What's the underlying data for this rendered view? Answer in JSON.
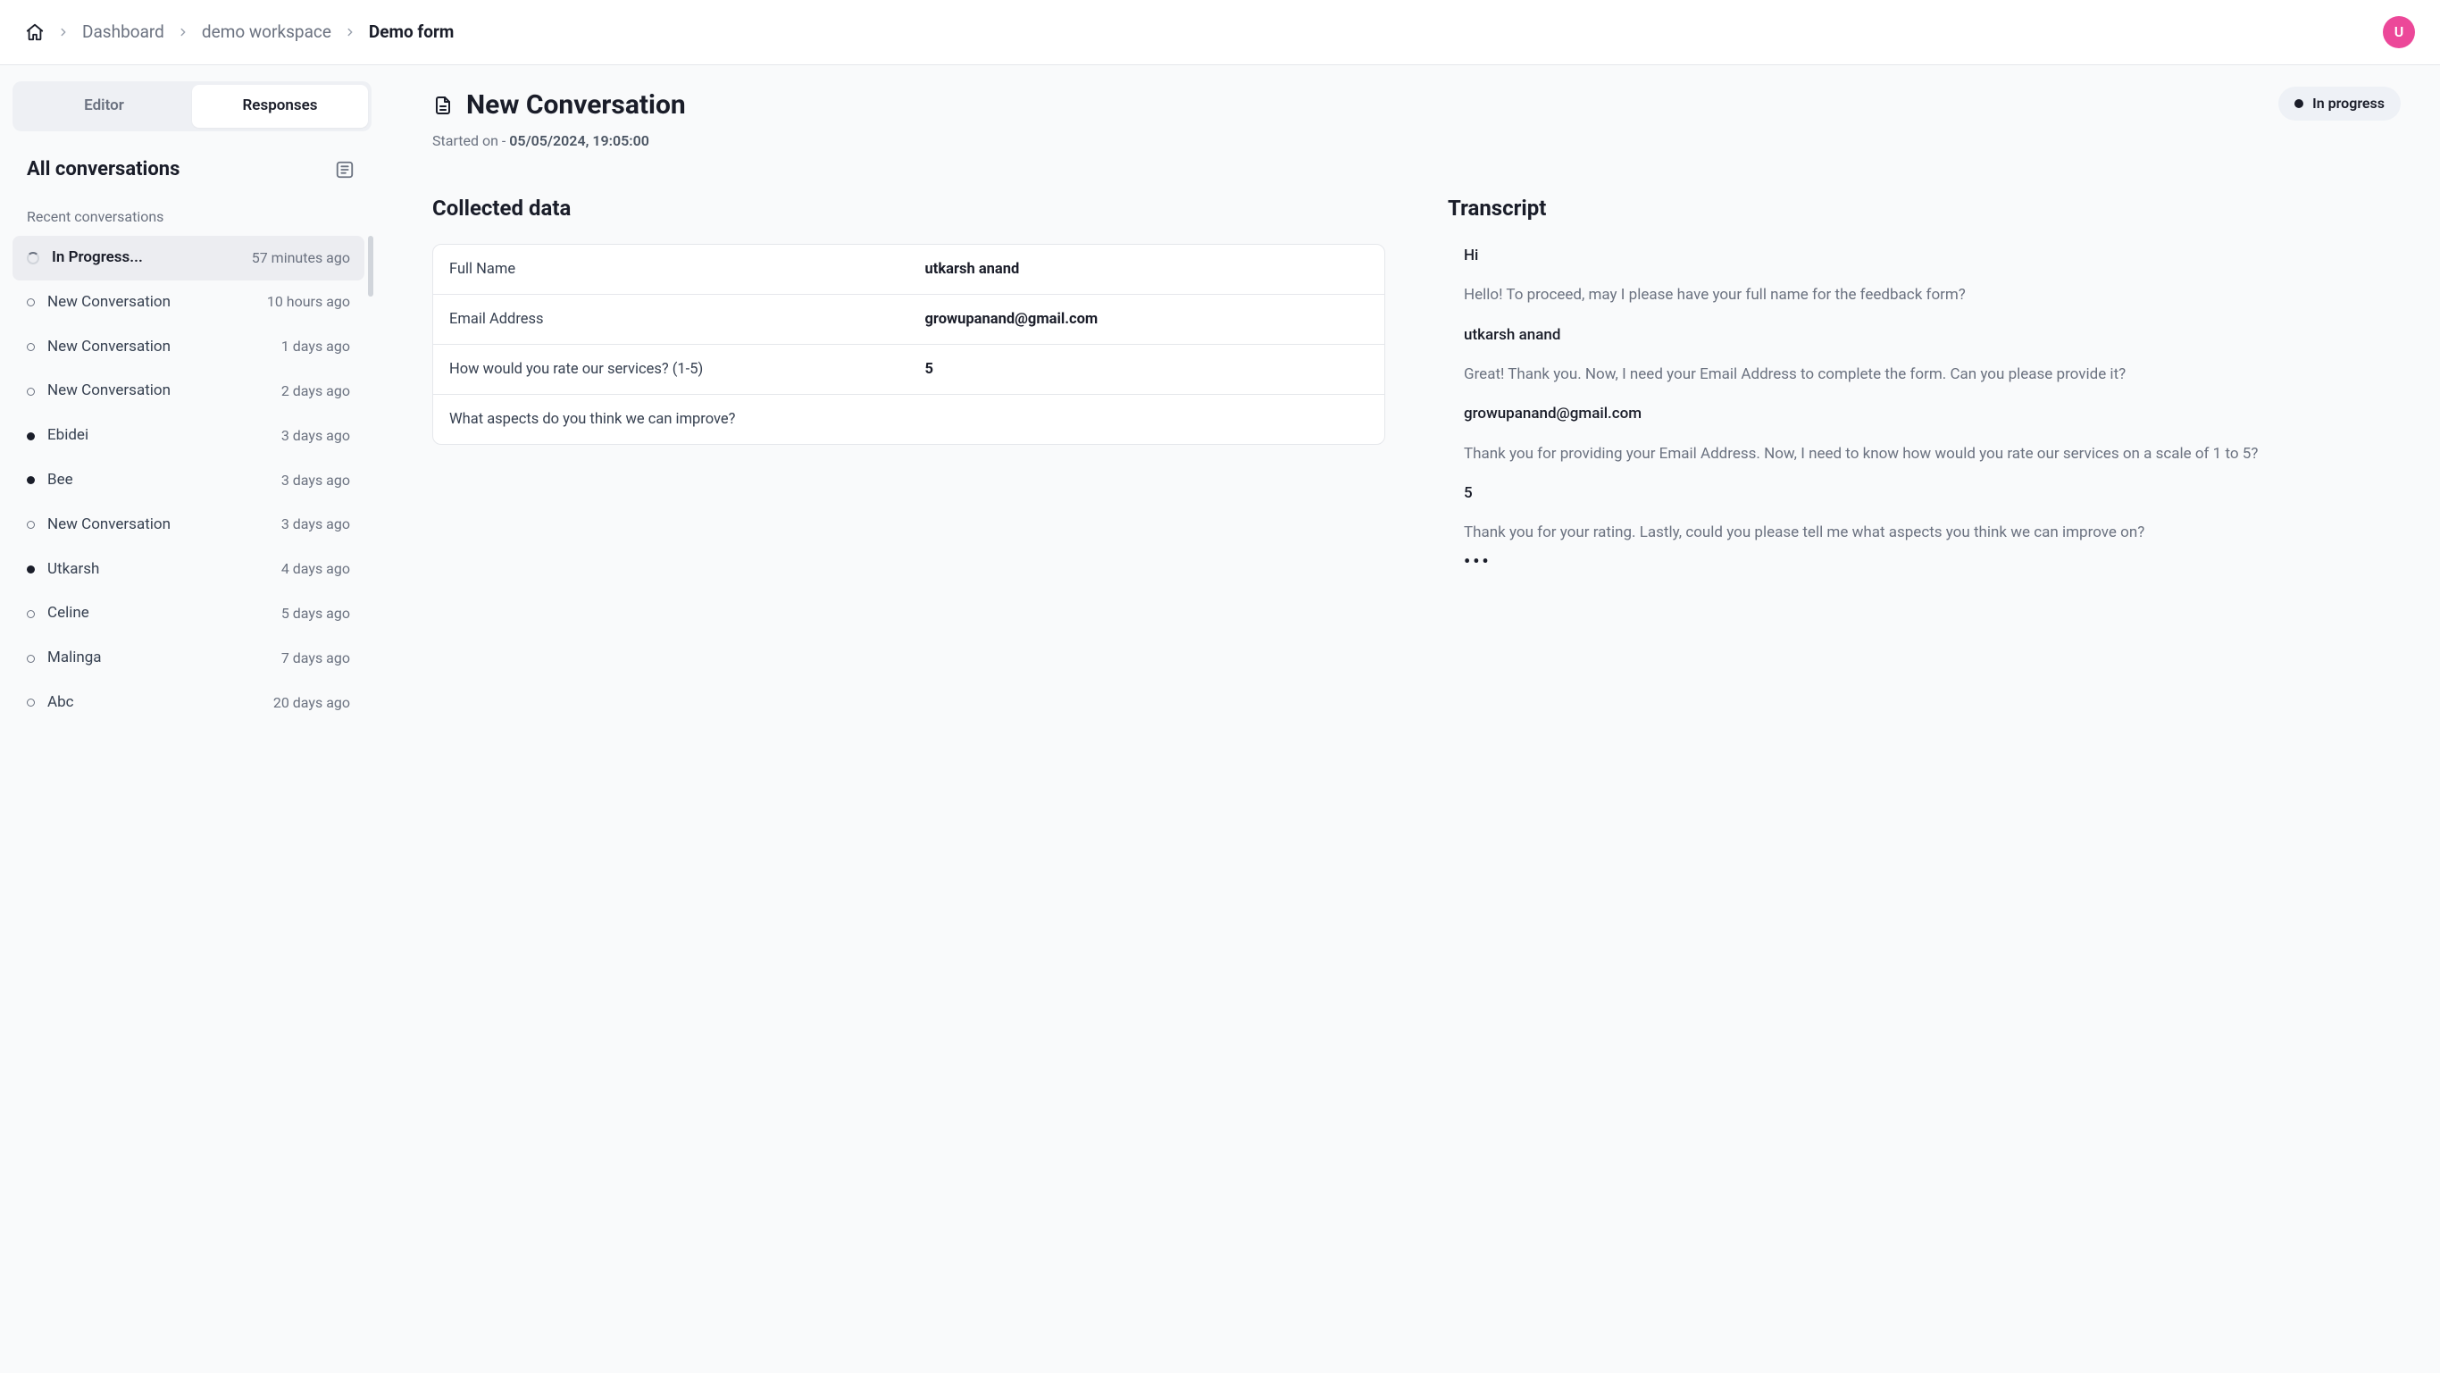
{
  "breadcrumb": {
    "items": [
      {
        "label": "Dashboard"
      },
      {
        "label": "demo workspace"
      },
      {
        "label": "Demo form"
      }
    ]
  },
  "avatar": {
    "initial": "U"
  },
  "sidebar": {
    "tabs": [
      {
        "label": "Editor"
      },
      {
        "label": "Responses"
      }
    ],
    "active_tab_index": 1,
    "title": "All conversations",
    "section_label": "Recent conversations",
    "conversations": [
      {
        "title": "In Progress...",
        "time": "57 minutes ago",
        "status": "spinner",
        "active": true
      },
      {
        "title": "New Conversation",
        "time": "10 hours ago",
        "status": "open"
      },
      {
        "title": "New Conversation",
        "time": "1 days ago",
        "status": "open"
      },
      {
        "title": "New Conversation",
        "time": "2 days ago",
        "status": "open"
      },
      {
        "title": "Ebidei",
        "time": "3 days ago",
        "status": "closed"
      },
      {
        "title": "Bee",
        "time": "3 days ago",
        "status": "closed"
      },
      {
        "title": "New Conversation",
        "time": "3 days ago",
        "status": "open"
      },
      {
        "title": "Utkarsh",
        "time": "4 days ago",
        "status": "closed"
      },
      {
        "title": "Celine",
        "time": "5 days ago",
        "status": "open"
      },
      {
        "title": "Malinga",
        "time": "7 days ago",
        "status": "open"
      },
      {
        "title": "Abc",
        "time": "20 days ago",
        "status": "open"
      }
    ]
  },
  "content": {
    "title": "New Conversation",
    "started_label": "Started on - ",
    "started_ts": "05/05/2024, 19:05:00",
    "status_label": "In progress",
    "collected_heading": "Collected data",
    "collected": [
      {
        "label": "Full Name",
        "value": "utkarsh anand"
      },
      {
        "label": "Email Address",
        "value": "growupanand@gmail.com"
      },
      {
        "label": "How would you rate our services? (1-5)",
        "value": "5"
      },
      {
        "label": "What aspects do you think we can improve?",
        "value": ""
      }
    ],
    "transcript_heading": "Transcript",
    "transcript": [
      {
        "role": "user",
        "text": "Hi"
      },
      {
        "role": "bot",
        "text": "Hello! To proceed, may I please have your full name for the feedback form?"
      },
      {
        "role": "user",
        "text": "utkarsh anand"
      },
      {
        "role": "bot",
        "text": "Great! Thank you. Now, I need your Email Address to complete the form. Can you please provide it?"
      },
      {
        "role": "user",
        "text": "growupanand@gmail.com"
      },
      {
        "role": "bot",
        "text": "Thank you for providing your Email Address. Now, I need to know how would you rate our services on a scale of 1 to 5?"
      },
      {
        "role": "user",
        "text": "5"
      },
      {
        "role": "bot",
        "text": "Thank you for your rating. Lastly, could you please tell me what aspects you think we can improve on?"
      }
    ],
    "typing_indicator": "•••"
  }
}
